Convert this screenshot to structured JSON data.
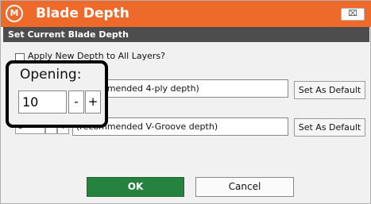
{
  "window": {
    "logo": "M",
    "title": "Blade Depth",
    "close_glyph": "⌧"
  },
  "section_title": "Set Current Blade Depth",
  "apply_all": {
    "label": "Apply New Depth to All Layers?",
    "checked": false
  },
  "rows": [
    {
      "description": "(recommended 4-ply depth)",
      "default_button": "Set As Default"
    },
    {
      "value": "6",
      "minus": "-",
      "plus": "+",
      "description": "(recommended V-Groove depth)",
      "default_button": "Set As Default"
    }
  ],
  "callout": {
    "label": "Opening:",
    "value": "10",
    "minus": "-",
    "plus": "+"
  },
  "buttons": {
    "ok": "OK",
    "cancel": "Cancel"
  },
  "colors": {
    "titlebar": "#ee6a2b",
    "section_bar": "#4d4d4d",
    "ok_button": "#26823f"
  }
}
